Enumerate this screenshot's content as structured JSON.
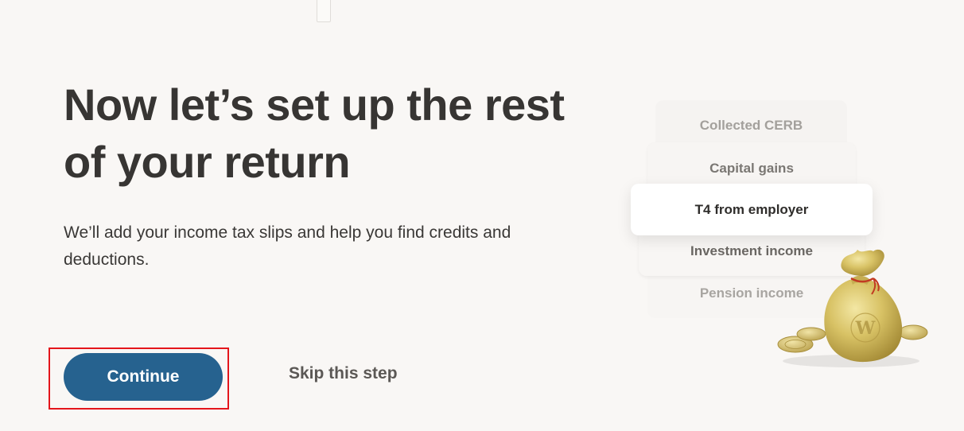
{
  "heading": "Now let’s set up the rest of your return",
  "subtext": "We’ll add your income tax slips and help you find credits and deductions.",
  "actions": {
    "continue_label": "Continue",
    "skip_label": "Skip this step"
  },
  "income_cards": [
    "Collected CERB",
    "Capital gains",
    "T4 from employer",
    "Investment income",
    "Pension income"
  ],
  "illustration": {
    "icon": "money-bag-icon",
    "bag_letter": "W"
  },
  "colors": {
    "background": "#f9f7f5",
    "primary_button": "#26628f",
    "highlight_border": "#e4151b",
    "heading": "#373533"
  }
}
